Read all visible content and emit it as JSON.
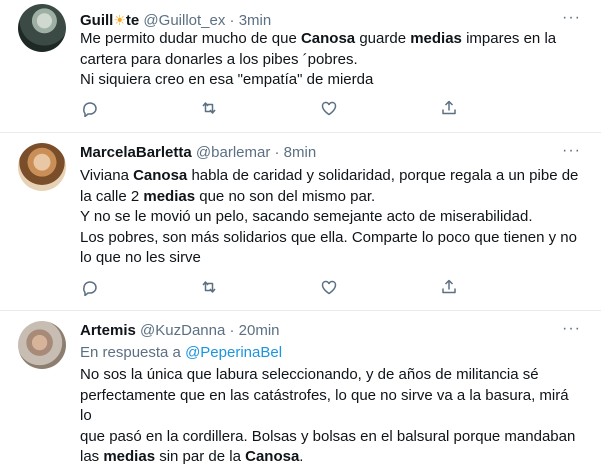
{
  "tweets": [
    {
      "name_before": "Guill",
      "name_emoji": "☀",
      "name_after": "te",
      "handle": "@Guillot_ex",
      "sep": "·",
      "time": "3min",
      "more": "···",
      "lines": [
        [
          {
            "t": "Me permito dudar mucho de que "
          },
          {
            "t": "Canosa",
            "b": true
          },
          {
            "t": " guarde "
          },
          {
            "t": "medias",
            "b": true
          },
          {
            "t": " impares en la"
          }
        ],
        [
          {
            "t": "cartera para donarles a los pibes ´pobres."
          }
        ],
        [
          {
            "t": "Ni siquiera creo en esa \"empatía\" de mierda"
          }
        ]
      ]
    },
    {
      "name": "MarcelaBarletta",
      "handle": "@barlemar",
      "sep": "·",
      "time": "8min",
      "more": "···",
      "lines": [
        [
          {
            "t": "Viviana "
          },
          {
            "t": "Canosa",
            "b": true
          },
          {
            "t": " habla de caridad y solidaridad,  porque regala a un pibe de"
          }
        ],
        [
          {
            "t": "la calle 2 "
          },
          {
            "t": "medias",
            "b": true
          },
          {
            "t": " que no son del mismo par."
          }
        ],
        [
          {
            "t": "Y no se le movió un pelo, sacando semejante acto de miserabilidad."
          }
        ],
        [
          {
            "t": "Los pobres, son más solidarios que ella. Comparte lo poco que tienen y no"
          }
        ],
        [
          {
            "t": "lo que no les sirve"
          }
        ]
      ]
    },
    {
      "name": "Artemis",
      "handle": "@KuzDanna",
      "sep": "·",
      "time": "20min",
      "more": "···",
      "reply_prefix": "En respuesta a ",
      "reply_to": "@PeperinaBel",
      "lines": [
        [
          {
            "t": "No sos la única que labura seleccionando, y de años de militancia sé"
          }
        ],
        [
          {
            "t": "perfectamente que en las catástrofes, lo que no sirve va a la basura, mirá lo"
          }
        ],
        [
          {
            "t": "que pasó en la cordillera. Bolsas y bolsas en el balsural porque mandaban"
          }
        ],
        [
          {
            "t": "las "
          },
          {
            "t": "medias",
            "b": true
          },
          {
            "t": " sin par de la "
          },
          {
            "t": "Canosa",
            "b": true
          },
          {
            "t": "."
          }
        ]
      ]
    }
  ],
  "action_icons": [
    "reply-icon",
    "retweet-icon",
    "like-icon",
    "share-icon"
  ],
  "colors": {
    "secondary_text": "#5b7083",
    "link": "#1b95e0",
    "divider": "#e6ecf0"
  }
}
